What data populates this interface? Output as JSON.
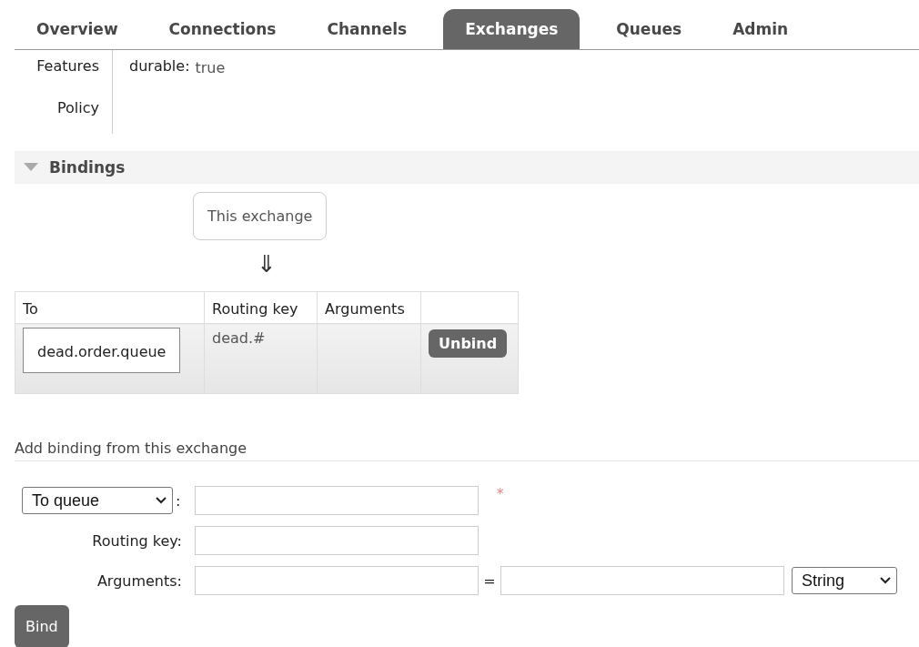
{
  "nav": {
    "tabs": [
      {
        "label": "Overview",
        "selected": false
      },
      {
        "label": "Connections",
        "selected": false
      },
      {
        "label": "Channels",
        "selected": false
      },
      {
        "label": "Exchanges",
        "selected": true
      },
      {
        "label": "Queues",
        "selected": false
      },
      {
        "label": "Admin",
        "selected": false
      }
    ]
  },
  "properties": [
    {
      "label": "Features",
      "key": "durable:",
      "value": "true"
    },
    {
      "label": "Policy"
    }
  ],
  "bindings": {
    "title": "Bindings",
    "expanded": true,
    "source": "This exchange",
    "arrow": "⇓",
    "columns": [
      "To",
      "Routing key",
      "Arguments"
    ],
    "rows": [
      {
        "to": "dead.order.queue",
        "routing_key": "dead.#",
        "action": "Unbind"
      }
    ]
  },
  "add_binding": {
    "title": "Add binding from this exchange",
    "destination_type": "To queue",
    "separator": ":",
    "required_mark": "*",
    "routing_key_label": "Routing key:",
    "arguments_label": "Arguments:",
    "equals": "=",
    "argument_type": "String",
    "submit": "Bind"
  }
}
